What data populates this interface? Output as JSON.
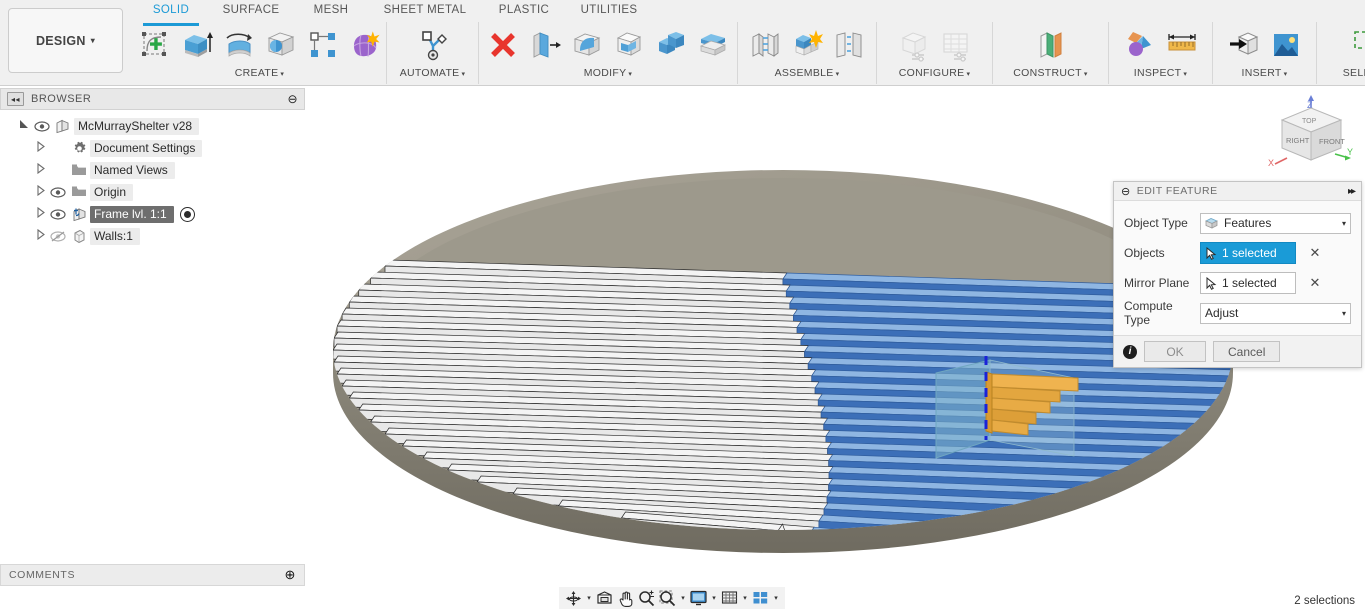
{
  "ribbon": {
    "design_button": {
      "label": "DESIGN",
      "caret": "▾"
    },
    "tabs": [
      {
        "label": "SOLID",
        "active": true
      },
      {
        "label": "SURFACE",
        "active": false
      },
      {
        "label": "MESH",
        "active": false
      },
      {
        "label": "SHEET METAL",
        "active": false
      },
      {
        "label": "PLASTIC",
        "active": false
      },
      {
        "label": "UTILITIES",
        "active": false
      }
    ],
    "panels": [
      {
        "label": "CREATE",
        "caret": "▾",
        "icons": [
          "create-sketch-icon",
          "extrude-icon",
          "revolve-icon",
          "sweep-icon",
          "pattern-icon",
          "form-icon"
        ]
      },
      {
        "label": "AUTOMATE",
        "caret": "▾",
        "icons": [
          "automate-icon"
        ]
      },
      {
        "label": "MODIFY",
        "caret": "▾",
        "icons": [
          "delete-icon",
          "press-pull-icon",
          "fillet-icon",
          "shell-icon",
          "combine-icon",
          "split-face-icon"
        ]
      },
      {
        "label": "ASSEMBLE",
        "caret": "▾",
        "icons": [
          "joint-icon",
          "as-built-joint-icon",
          "rigid-group-icon"
        ]
      },
      {
        "label": "CONFIGURE",
        "caret": "▾",
        "icons": [
          "configure-model-icon",
          "configure-table-icon"
        ]
      },
      {
        "label": "CONSTRUCT",
        "caret": "▾",
        "icons": [
          "construct-plane-icon"
        ]
      },
      {
        "label": "INSPECT",
        "caret": "▾",
        "icons": [
          "interference-icon",
          "measure-icon"
        ]
      },
      {
        "label": "INSERT",
        "caret": "▾",
        "icons": [
          "insert-derive-icon",
          "insert-image-icon"
        ]
      },
      {
        "label": "SELECT",
        "caret": "▾",
        "icons": [
          "select-window-icon"
        ]
      }
    ]
  },
  "browser": {
    "title": "BROWSER",
    "collapse_icon": "◂◂",
    "minimize_icon": "⊖",
    "nodes": [
      {
        "label": "McMurrayShelter v28",
        "indent": 0,
        "arrow": "expanded",
        "eye": "visible",
        "icon": "component-icon",
        "selected": false,
        "activated": false
      },
      {
        "label": "Document Settings",
        "indent": 1,
        "arrow": "collapsed",
        "eye": "none",
        "icon": "gear-icon",
        "selected": false,
        "activated": false
      },
      {
        "label": "Named Views",
        "indent": 1,
        "arrow": "collapsed",
        "eye": "none",
        "icon": "folder-icon",
        "selected": false,
        "activated": false
      },
      {
        "label": "Origin",
        "indent": 1,
        "arrow": "collapsed",
        "eye": "visible",
        "icon": "origin-folder-icon",
        "selected": false,
        "activated": false
      },
      {
        "label": "Frame lvl. 1:1",
        "indent": 1,
        "arrow": "collapsed",
        "eye": "visible",
        "icon": "component-anchor-icon",
        "selected": true,
        "activated": true
      },
      {
        "label": "Walls:1",
        "indent": 1,
        "arrow": "collapsed",
        "eye": "hidden",
        "icon": "body-icon",
        "selected": false,
        "activated": false
      }
    ]
  },
  "comments": {
    "label": "COMMENTS",
    "add_icon": "⊕"
  },
  "dialog": {
    "title": "EDIT FEATURE",
    "collapse_icon": "⊖",
    "expand_icon": "▸▸",
    "rows": [
      {
        "label": "Object Type",
        "type": "select",
        "value": "Features",
        "icon": "features-icon",
        "caret": "▾"
      },
      {
        "label": "Objects",
        "type": "selection",
        "value": "1 selected",
        "icon": "cursor-icon",
        "clear": "✕",
        "highlighted": true
      },
      {
        "label": "Mirror Plane",
        "type": "selection",
        "value": "1 selected",
        "icon": "cursor-icon",
        "clear": "✕",
        "highlighted": false
      },
      {
        "label": "Compute Type",
        "type": "select",
        "value": "Adjust",
        "icon": "",
        "caret": "▾"
      }
    ],
    "info_icon": "i",
    "ok_label": "OK",
    "cancel_label": "Cancel"
  },
  "viewcube": {
    "faces": {
      "top": "TOP",
      "left": "RIGHT",
      "right": "FRONT"
    },
    "axes": [
      {
        "name": "X",
        "color": "#e06666"
      },
      {
        "name": "Y",
        "color": "#49c24a"
      },
      {
        "name": "Z",
        "color": "#6a7fd6"
      }
    ]
  },
  "navbar": {
    "buttons": [
      {
        "name": "orbit-icon",
        "caret": true
      },
      {
        "name": "look-at-icon",
        "caret": false
      },
      {
        "name": "pan-icon",
        "caret": false
      },
      {
        "name": "zoom-icon",
        "caret": false
      },
      {
        "name": "zoom-window-icon",
        "caret": true
      },
      {
        "name": "display-settings-icon",
        "caret": true
      },
      {
        "name": "grid-snaps-icon",
        "caret": true
      },
      {
        "name": "viewports-icon",
        "caret": true
      }
    ]
  },
  "status": {
    "selection_text": "2 selections"
  },
  "model": {
    "name": "circular-joist-frame",
    "base_color": "#9a9588",
    "unselected_joist_color": "#e8e8e8",
    "selected_joist_color": "#3c6fb8",
    "edit_feature_color": "#e8a33d",
    "mirror_plane_color": "#7fb4cc",
    "construction_line_color": "#1a22d8",
    "joist_count": 26
  }
}
